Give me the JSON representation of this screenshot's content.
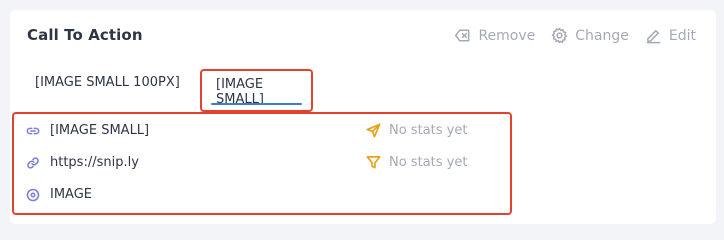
{
  "card": {
    "title": "Call To Action",
    "actions": {
      "remove_label": "Remove",
      "change_label": "Change",
      "edit_label": "Edit"
    },
    "tabs": [
      {
        "label": "[IMAGE SMALL 100PX]",
        "selected": false
      },
      {
        "label": "[IMAGE SMALL]",
        "selected": true
      }
    ],
    "details": {
      "rows": [
        {
          "icon": "link-icon",
          "text": "[IMAGE SMALL]"
        },
        {
          "icon": "link-icon",
          "text": "https://snip.ly"
        },
        {
          "icon": "image-icon",
          "text": "IMAGE"
        }
      ],
      "stats": [
        {
          "icon": "send-icon",
          "text": "No stats yet"
        },
        {
          "icon": "filter-icon",
          "text": "No stats yet"
        }
      ]
    }
  },
  "colors": {
    "highlight": "#e2432e",
    "tab_underline": "#3e7fc4",
    "icon_purple": "#7d7fd8",
    "icon_orange": "#e6a118"
  }
}
